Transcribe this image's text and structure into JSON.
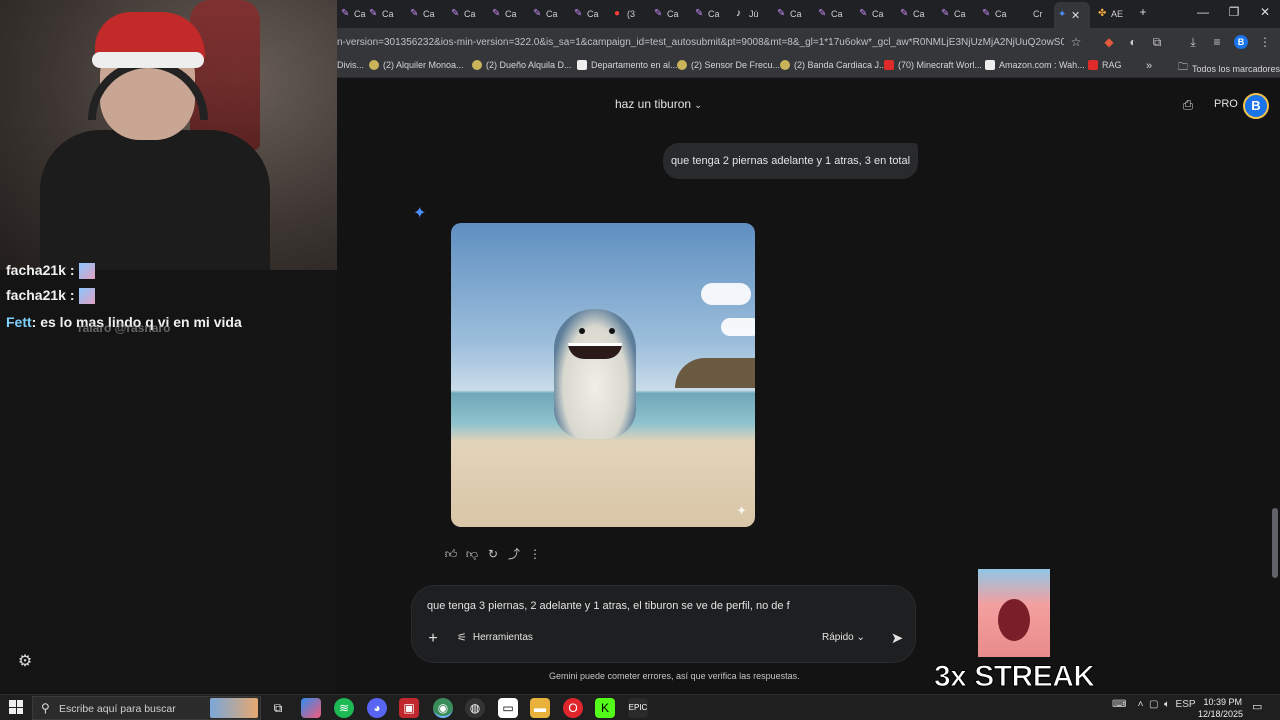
{
  "stream": {
    "chat": [
      {
        "user": "facha21k",
        "sep": " :",
        "message": "",
        "emote": "emote"
      },
      {
        "user": "facha21k",
        "sep": " :",
        "message": "",
        "emote": "emote"
      },
      {
        "user": "Fett",
        "sep": "",
        "message": ": es lo mas lindo q vi en mi vida",
        "overlay": "raiaro @rasnaro"
      }
    ],
    "streak": "3x STREAK"
  },
  "browser": {
    "tabs": [
      {
        "label": "Ca"
      },
      {
        "label": "Ca"
      },
      {
        "label": "Ca"
      },
      {
        "label": "Ca"
      },
      {
        "label": "Ca"
      },
      {
        "label": "Ca"
      },
      {
        "label": "Ca"
      },
      {
        "label": "(3"
      },
      {
        "label": "Ca"
      },
      {
        "label": "Ca"
      },
      {
        "label": "Jú"
      },
      {
        "label": "Ca"
      },
      {
        "label": "Ca"
      },
      {
        "label": "Ca"
      },
      {
        "label": "Ca"
      },
      {
        "label": "Ca"
      },
      {
        "label": "Ca"
      },
      {
        "label": "Cr"
      },
      {
        "label": ""
      },
      {
        "label": "AE"
      }
    ],
    "url": "n-version=301356232&ios-min-version=322.0&is_sa=1&campaign_id=test_autosubmit&pt=9008&mt=8&_gl=1*17u6okw*_gcl_aw*R0NMLjE3NjUzMjA2NjUuQ2owS0NRaUFy...",
    "bookmarks": [
      {
        "label": "Divis...",
        "icon": "folder"
      },
      {
        "label": "(2) Alquiler Monoa...",
        "icon": "marketplace"
      },
      {
        "label": "(2) Dueño Alquila D...",
        "icon": "marketplace"
      },
      {
        "label": "Departamento en al...",
        "icon": "house"
      },
      {
        "label": "(2) Sensor De Frecu...",
        "icon": "marketplace"
      },
      {
        "label": "(2) Banda Cardiaca J...",
        "icon": "marketplace"
      },
      {
        "label": "(70) Minecraft Worl...",
        "icon": "youtube"
      },
      {
        "label": "Amazon.com : Wah...",
        "icon": "amazon"
      },
      {
        "label": "RAG",
        "icon": "youtube"
      }
    ],
    "bookmarks_more": "»",
    "all_bookmarks": "Todos los marcadores",
    "profile": "B"
  },
  "gemini": {
    "conversation_title": "haz un tiburon",
    "pro_label": "PRO",
    "avatar_letter": "B",
    "user_message": "que tenga 2 piernas adelante y 1 atras, 3 en total",
    "input_value": "que tenga 3 piernas, 2 adelante y 1 atras, el tiburon se ve de perfil, no de f",
    "tools_label": "Herramientas",
    "speed_label": "Rápido",
    "disclaimer": "Gemini puede cometer errores, así que verifica las respuestas."
  },
  "taskbar": {
    "search_placeholder": "Escribe aquí para buscar",
    "language": "ESP",
    "time": "10:39 PM",
    "date": "12/18/2025"
  }
}
